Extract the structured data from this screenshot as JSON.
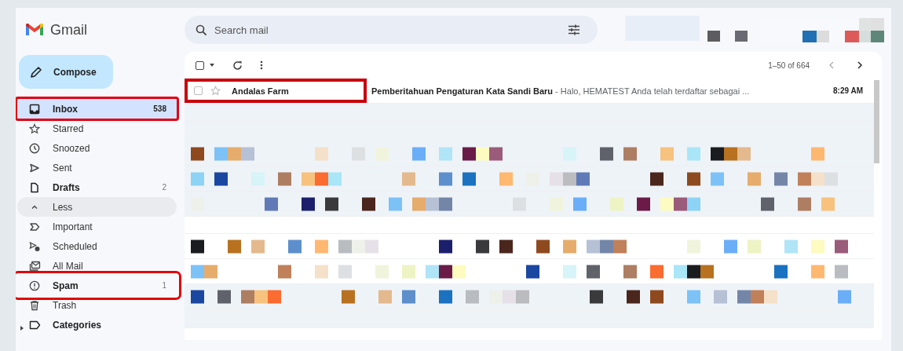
{
  "app": {
    "name": "Gmail"
  },
  "search": {
    "placeholder": "Search mail"
  },
  "compose": {
    "label": "Compose"
  },
  "nav": [
    {
      "label": "Inbox",
      "count": "538",
      "selected": true,
      "unread": true,
      "marked": true
    },
    {
      "label": "Starred",
      "selected": false,
      "unread": false,
      "marked": false
    },
    {
      "label": "Snoozed",
      "selected": false,
      "unread": false,
      "marked": false
    },
    {
      "label": "Sent",
      "selected": false,
      "unread": false,
      "marked": false
    },
    {
      "label": "Drafts",
      "count": "2",
      "selected": false,
      "unread": true,
      "marked": false
    },
    {
      "label": "Less",
      "kind": "toggle",
      "selected": false,
      "unread": false,
      "marked": false
    },
    {
      "label": "Important",
      "selected": false,
      "unread": false,
      "marked": false
    },
    {
      "label": "Scheduled",
      "selected": false,
      "unread": false,
      "marked": false
    },
    {
      "label": "All Mail",
      "selected": false,
      "unread": false,
      "marked": false
    },
    {
      "label": "Spam",
      "count": "1",
      "selected": false,
      "unread": true,
      "marked": true
    },
    {
      "label": "Trash",
      "selected": false,
      "unread": false,
      "marked": false
    },
    {
      "label": "Categories",
      "kind": "group",
      "expanded": false,
      "selected": false,
      "unread": true,
      "marked": false
    }
  ],
  "toolbar": {
    "range": "1–50 of 664",
    "all_checked": false
  },
  "messages": [
    {
      "kind": "email",
      "sender": "Andalas Farm",
      "subject": "Pemberitahuan Pengaturan Kata Sandi Baru",
      "snippet": "- Halo, HEMATEST Anda telah terdaftar sebagai ...",
      "time": "8:29 AM",
      "read": false,
      "starred": false,
      "checked": false,
      "marked": true
    },
    {
      "kind": "empty",
      "read": true
    },
    {
      "kind": "empty",
      "read": true
    },
    {
      "kind": "redacted",
      "read": true
    },
    {
      "kind": "redacted",
      "read": true
    },
    {
      "kind": "redacted",
      "read": true
    },
    {
      "kind": "empty",
      "read": false
    },
    {
      "kind": "redacted",
      "read": false
    },
    {
      "kind": "redacted",
      "read": false
    },
    {
      "kind": "redacted",
      "read": true
    },
    {
      "kind": "empty",
      "read": true
    }
  ]
}
